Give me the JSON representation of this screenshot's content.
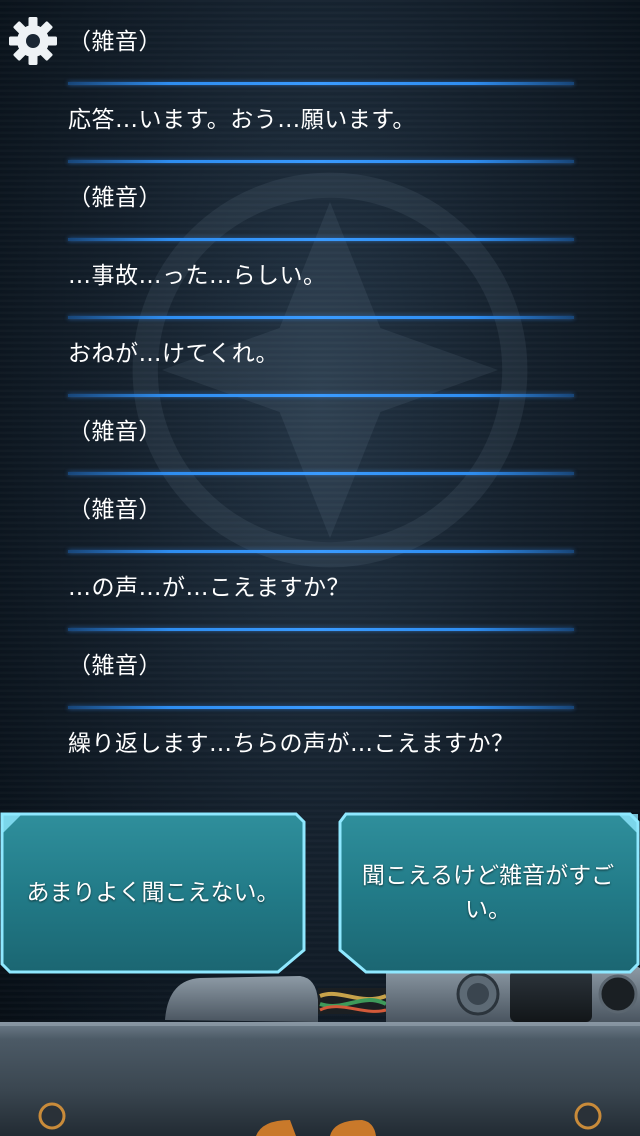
{
  "log": [
    "（雑音）",
    "応答…います。おう…願います。",
    "（雑音）",
    "…事故…った…らしい。",
    "おねが…けてくれ。",
    "（雑音）",
    "（雑音）",
    "…の声…が…こえますか？",
    "（雑音）",
    "繰り返します…ちらの声が…こえますか？"
  ],
  "choices": {
    "left": "あまりよく聞こえない。",
    "right": "聞こえるけど雑音がすごい。"
  },
  "icons": {
    "settings": "gear-icon"
  },
  "colors": {
    "divider": "#2e8df0",
    "button_fill": "#2b8f9a",
    "button_border": "#7fe3ff"
  }
}
